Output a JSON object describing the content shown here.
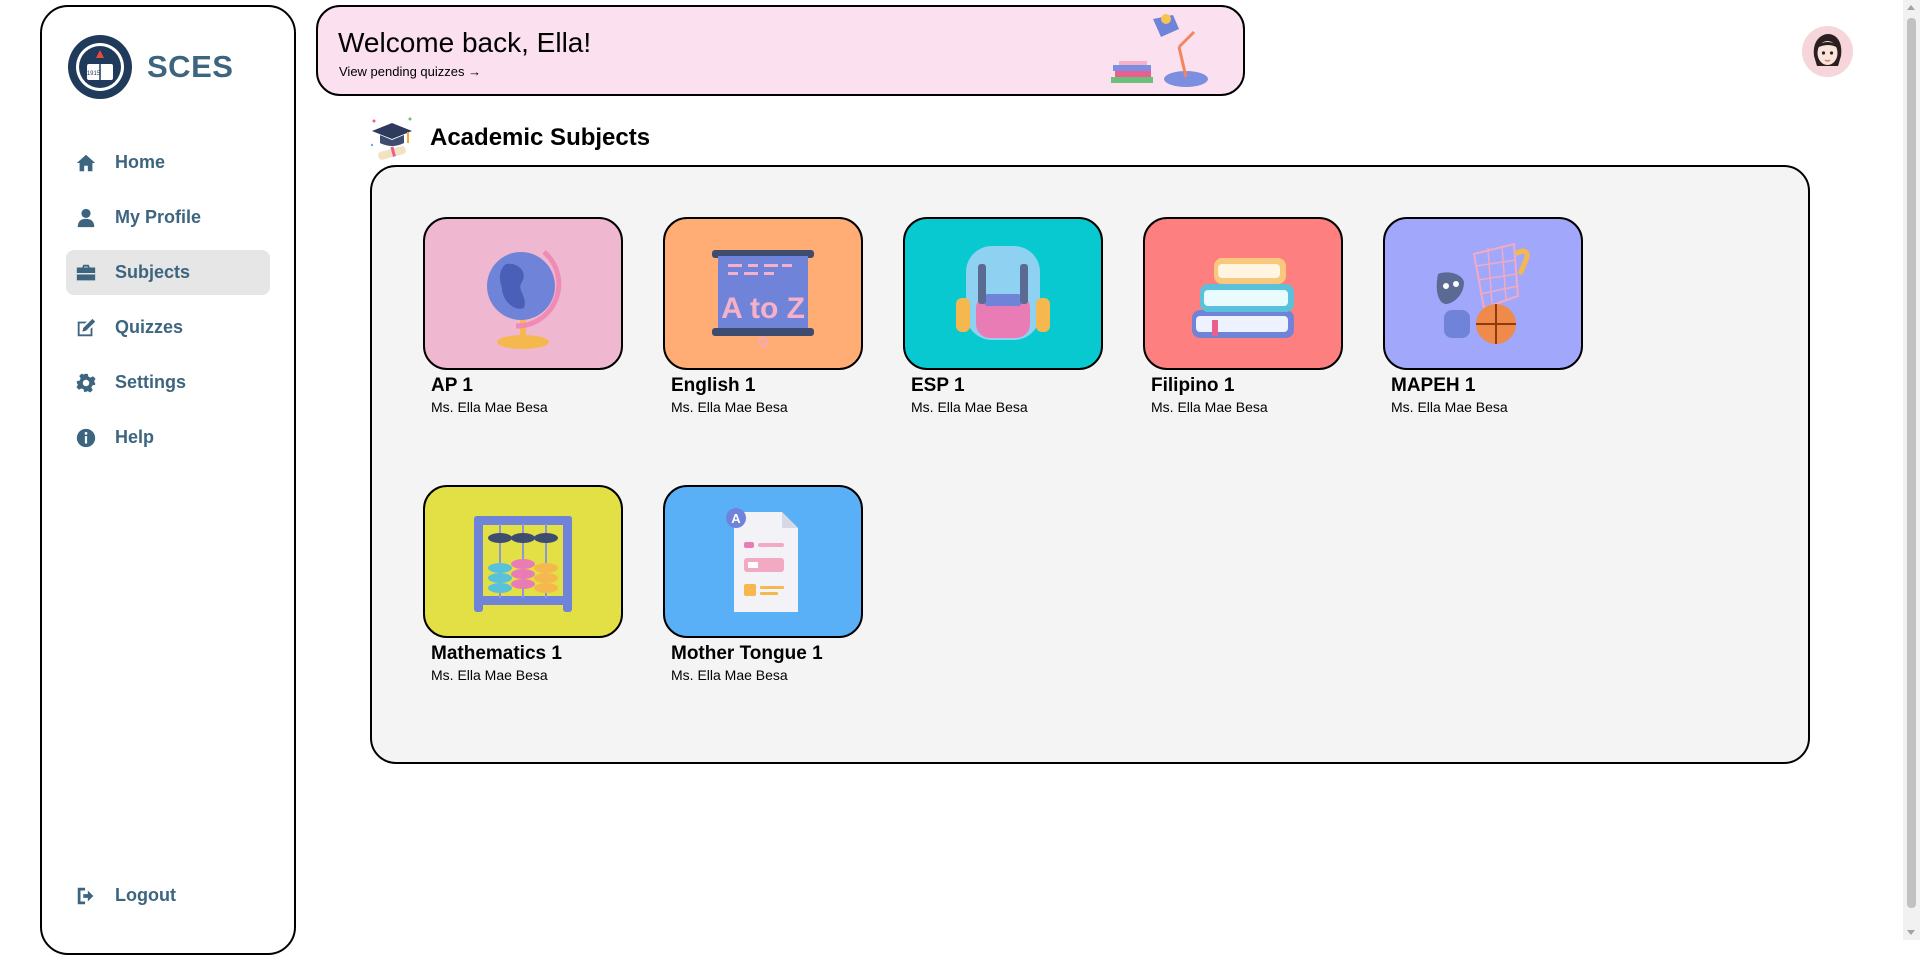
{
  "brand": {
    "name": "SCES",
    "logo_icon": "school-seal-icon",
    "logo_text": "1915"
  },
  "nav": [
    {
      "label": "Home",
      "icon": "home-icon"
    },
    {
      "label": "My Profile",
      "icon": "user-icon"
    },
    {
      "label": "Subjects",
      "icon": "briefcase-icon",
      "active": true
    },
    {
      "label": "Quizzes",
      "icon": "edit-icon"
    },
    {
      "label": "Settings",
      "icon": "gear-icon"
    },
    {
      "label": "Help",
      "icon": "info-icon"
    }
  ],
  "logout": {
    "label": "Logout",
    "icon": "logout-icon"
  },
  "banner": {
    "title": "Welcome back, Ella!",
    "link": "View pending quizzes →",
    "background": "#fbe0ef"
  },
  "section": {
    "title": "Academic Subjects",
    "icon": "graduation-cap-icon"
  },
  "subjects": [
    {
      "title": "AP 1",
      "teacher": "Ms. Ella Mae Besa",
      "color": "#efb8d0",
      "icon": "globe-icon"
    },
    {
      "title": "English 1",
      "teacher": "Ms. Ella Mae Besa",
      "color": "#ffad75",
      "icon": "a-to-z-board-icon",
      "board_text": "A to Z"
    },
    {
      "title": "ESP 1",
      "teacher": "Ms. Ella Mae Besa",
      "color": "#08c9cf",
      "icon": "backpack-icon"
    },
    {
      "title": "Filipino 1",
      "teacher": "Ms. Ella Mae Besa",
      "color": "#fd7f7f",
      "icon": "books-icon"
    },
    {
      "title": "MAPEH 1",
      "teacher": "Ms. Ella Mae Besa",
      "color": "#a1a8fb",
      "icon": "arts-sports-icon"
    },
    {
      "title": "Mathematics 1",
      "teacher": "Ms. Ella Mae Besa",
      "color": "#e2e044",
      "icon": "abacus-icon"
    },
    {
      "title": "Mother Tongue 1",
      "teacher": "Ms. Ella Mae Besa",
      "color": "#5ab0f7",
      "icon": "document-icon",
      "doc_badge": "A"
    }
  ],
  "avatar": {
    "icon": "avatar-girl-icon"
  }
}
